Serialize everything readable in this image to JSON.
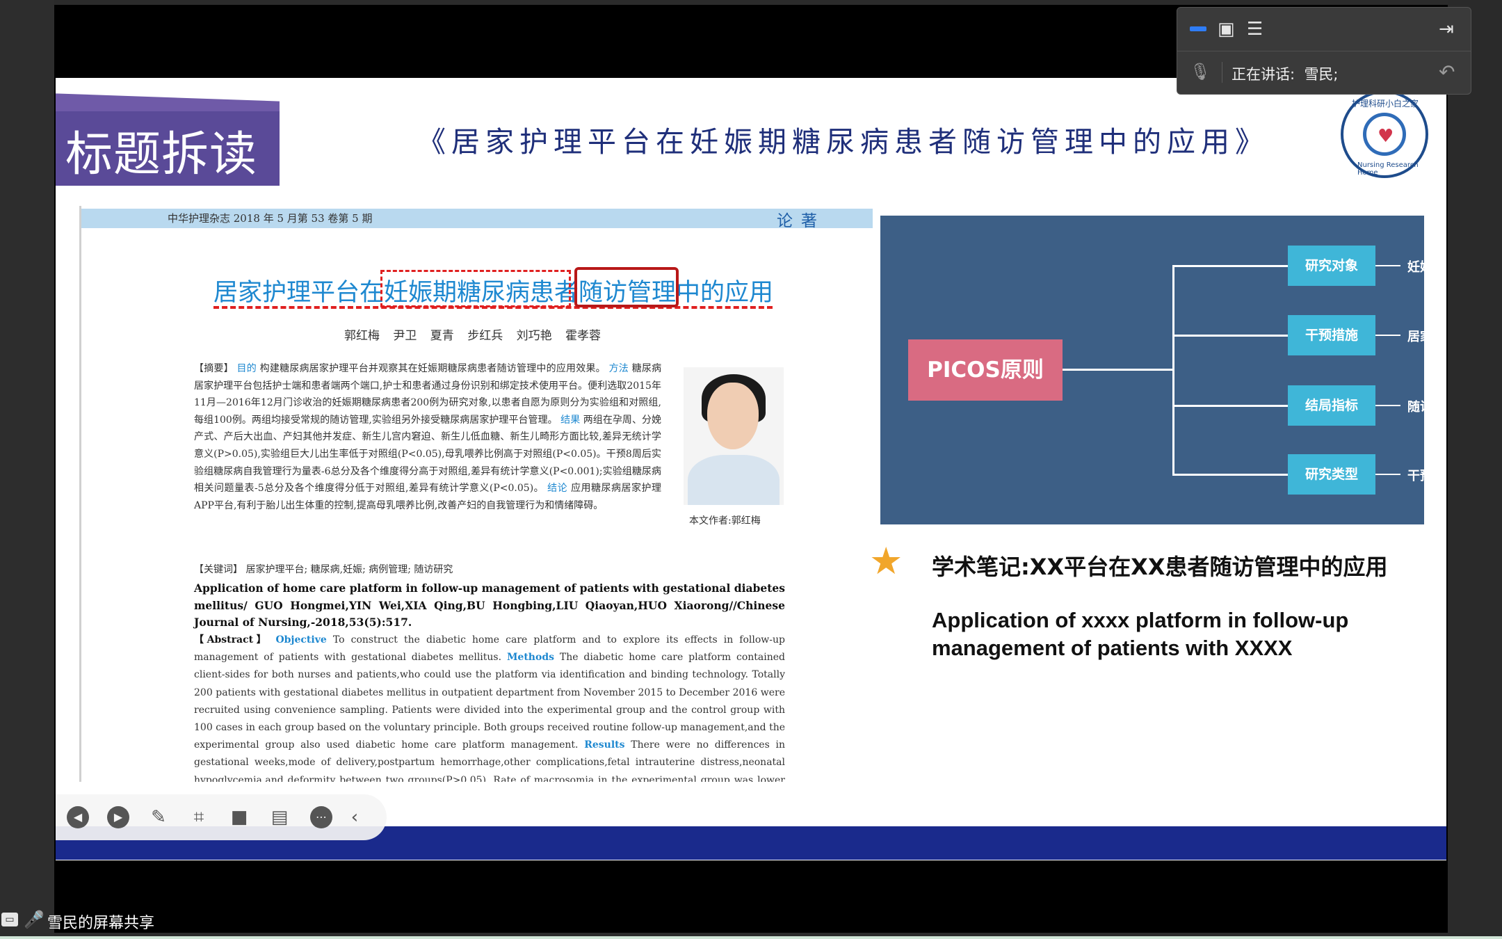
{
  "meeting_panel": {
    "icons": [
      "minimize-icon",
      "window-icon",
      "list-layout-icon",
      "collapse-panel-icon"
    ],
    "speaking_label": "正在讲话:",
    "speaker": "雪民;"
  },
  "slide": {
    "tag_text": "标题拆读",
    "title": "《居家护理平台在妊娠期糖尿病患者随访管理中的应用》",
    "logo_top_text": "护理科研小白之家",
    "logo_bottom_text": "Nursing Research Home"
  },
  "paper": {
    "journal": "中华护理杂志 2018 年 5 月第 53 卷第 5 期",
    "section": "论著",
    "title": "居家护理平台在妊娠期糖尿病患者随访管理中的应用",
    "authors": "郭红梅 尹卫 夏青 步红兵 刘巧艳 霍孝蓉",
    "abstract_label": "【摘要】",
    "kw_objective": "目的",
    "abstract_objective": "构建糖尿病居家护理平台并观察其在妊娠期糖尿病患者随访管理中的应用效果。",
    "kw_method": "方法",
    "abstract_method": "糖尿病居家护理平台包括护士端和患者端两个端口,护士和患者通过身份识别和绑定技术使用平台。便利选取2015年11月—2016年12月门诊收治的妊娠期糖尿病患者200例为研究对象,以患者自愿为原则分为实验组和对照组,每组100例。两组均接受常规的随访管理,实验组另外接受糖尿病居家护理平台管理。",
    "kw_result": "结果",
    "abstract_result": "两组在孕周、分娩产式、产后大出血、产妇其他并发症、新生儿宫内窘迫、新生儿低血糖、新生儿畸形方面比较,差异无统计学意义(P>0.05),实验组巨大儿出生率低于对照组(P<0.05),母乳喂养比例高于对照组(P<0.05)。干预8周后实验组糖尿病自我管理行为量表-6总分及各个维度得分高于对照组,差异有统计学意义(P<0.001);实验组糖尿病相关问题量表-5总分及各个维度得分低于对照组,差异有统计学意义(P<0.05)。",
    "kw_conclusion": "结论",
    "abstract_conclusion": "应用糖尿病居家护理APP平台,有利于胎儿出生体重的控制,提高母乳喂养比例,改善产妇的自我管理行为和情绪障碍。",
    "keywords": "【关键词】 居家护理平台; 糖尿病,妊娠; 病例管理; 随访研究",
    "photo_caption": "本文作者:郭红梅",
    "en_title": "Application of home care platform in follow-up management of patients with gestational diabetes mellitus/ GUO Hongmei,YIN Wei,XIA Qing,BU Hongbing,LIU Qiaoyan,HUO Xiaorong//Chinese Journal of Nursing,-2018,53(5):517.",
    "en_abstract_label": "【Abstract】",
    "en_kw_objective": "Objective",
    "en_objective": "To construct the diabetic home care platform and to explore its effects in follow-up management of patients with gestational diabetes mellitus.",
    "en_kw_methods": "Methods",
    "en_methods": "The diabetic home care platform contained client-sides for both nurses and patients,who could use the platform via identification and binding technology. Totally 200 patients with gestational diabetes mellitus in outpatient department from November 2015 to December 2016 were recruited using convenience sampling. Patients were divided into the experimental group and the control group with 100 cases in each group based on the voluntary principle. Both groups received routine follow-up management,and the experimental group also used diabetic home care platform management.",
    "en_kw_results": "Results",
    "en_results": "There were no differences in gestational weeks,mode of delivery,postpartum hemorrhage,other complications,fetal intrauterine distress,neonatal hypoglycemia,and deformity between two groups(P>0.05). Rate of macrosomia in the experimental group was lower than"
  },
  "picos": {
    "center": "PICOS原则",
    "items": [
      {
        "box": "研究对象",
        "label": "妊娠期糖尿病患者(P)"
      },
      {
        "box": "干预措施",
        "label": "居家护理平台(I)"
      },
      {
        "box": "结局指标",
        "label": "随访管理(O)"
      },
      {
        "box": "研究类型",
        "label": "干预性研究(S)"
      }
    ]
  },
  "note": {
    "cn": "学术笔记:XX平台在XX患者随访管理中的应用",
    "en": "Application of xxxx platform in follow-up management of patients with XXXX"
  },
  "toolbar": {
    "buttons": [
      "previous-icon",
      "next-icon",
      "pen-icon",
      "screenshot-icon",
      "camera-icon",
      "comment-icon",
      "more-icon",
      "collapse-icon"
    ]
  },
  "share": {
    "label": "雪民的屏幕共享"
  },
  "colors": {
    "title_tag": "#5a4a98",
    "picos_bg": "#3d5f86",
    "picos_center": "#d96b82",
    "picos_box": "#3fb6d8",
    "paper_title": "#1e88d0",
    "highlight_red": "#e02020"
  }
}
